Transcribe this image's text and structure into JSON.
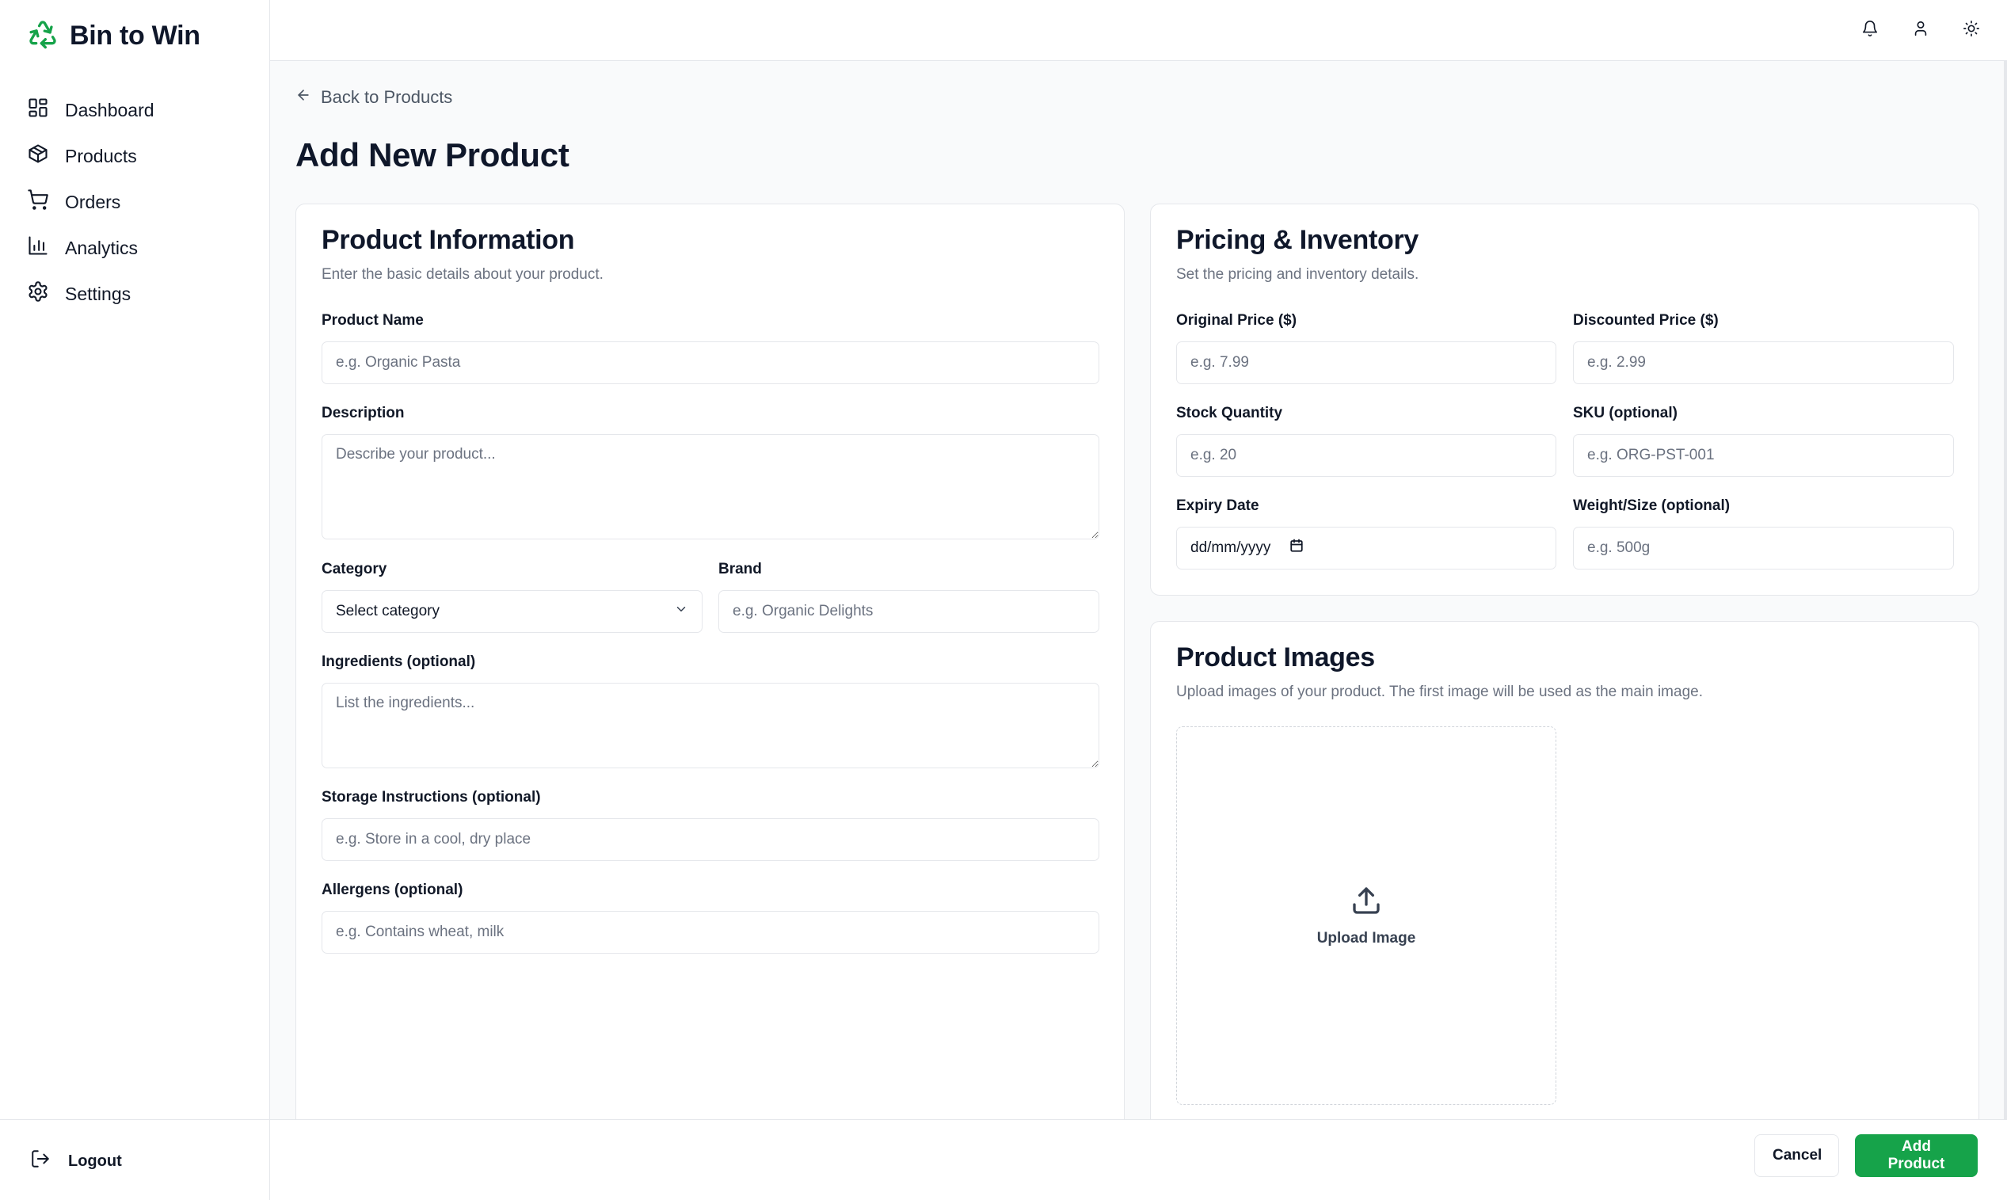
{
  "app": {
    "name": "Bin to Win",
    "logo_icon": "recycle-icon",
    "accent_color": "#16a34a"
  },
  "sidebar": {
    "items": [
      {
        "label": "Dashboard",
        "icon": "dashboard-icon"
      },
      {
        "label": "Products",
        "icon": "box-icon"
      },
      {
        "label": "Orders",
        "icon": "cart-icon"
      },
      {
        "label": "Analytics",
        "icon": "bar-chart-icon"
      },
      {
        "label": "Settings",
        "icon": "gear-icon"
      }
    ],
    "logout_label": "Logout"
  },
  "topbar": {
    "icons": [
      "bell-icon",
      "user-icon",
      "sun-icon"
    ]
  },
  "back_link": "Back to Products",
  "page_title": "Add New Product",
  "product_info": {
    "title": "Product Information",
    "subtitle": "Enter the basic details about your product.",
    "name_label": "Product Name",
    "name_placeholder": "e.g. Organic Pasta",
    "description_label": "Description",
    "description_placeholder": "Describe your product...",
    "category_label": "Category",
    "category_value": "Select category",
    "brand_label": "Brand",
    "brand_placeholder": "e.g. Organic Delights",
    "ingredients_label": "Ingredients (optional)",
    "ingredients_placeholder": "List the ingredients...",
    "storage_label": "Storage Instructions (optional)",
    "storage_placeholder": "e.g. Store in a cool, dry place",
    "allergens_label": "Allergens (optional)",
    "allergens_placeholder": "e.g. Contains wheat, milk"
  },
  "pricing": {
    "title": "Pricing & Inventory",
    "subtitle": "Set the pricing and inventory details.",
    "original_label": "Original Price ($)",
    "original_placeholder": "e.g. 7.99",
    "discounted_label": "Discounted Price ($)",
    "discounted_placeholder": "e.g. 2.99",
    "stock_label": "Stock Quantity",
    "stock_placeholder": "e.g. 20",
    "sku_label": "SKU (optional)",
    "sku_placeholder": "e.g. ORG-PST-001",
    "expiry_label": "Expiry Date",
    "expiry_value": "dd/mm/yyyy",
    "weight_label": "Weight/Size (optional)",
    "weight_placeholder": "e.g. 500g"
  },
  "images": {
    "title": "Product Images",
    "subtitle": "Upload images of your product. The first image will be used as the main image.",
    "upload_label": "Upload Image"
  },
  "footer": {
    "cancel_label": "Cancel",
    "add_label": "Add Product"
  }
}
